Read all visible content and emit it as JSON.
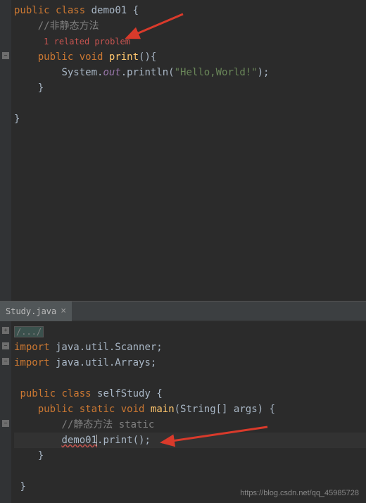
{
  "top_pane": {
    "code": {
      "l1_kw1": "public",
      "l1_kw2": "class",
      "l1_cls": "demo01",
      "l1_brace": " {",
      "l2_comment": "//非静态方法",
      "l3_problem": "1 related problem",
      "l4_kw1": "public",
      "l4_kw2": "void",
      "l4_method": "print",
      "l4_parens": "(){",
      "l5_sys": "System.",
      "l5_out": "out",
      "l5_print": ".println(",
      "l5_str": "\"Hello,World!\"",
      "l5_end": ");",
      "l6_brace": "}",
      "l7_brace": "}"
    }
  },
  "bottom_pane": {
    "tab_name": "Study.java",
    "code": {
      "folded": "/.../",
      "imp1_kw": "import",
      "imp1_rest": " java.util.Scanner;",
      "imp2_kw": "import",
      "imp2_rest": " java.util.Arrays;",
      "cls_kw1": "public",
      "cls_kw2": "class",
      "cls_name": "selfStudy",
      "cls_brace": " {",
      "main_kw1": "public",
      "main_kw2": "static",
      "main_kw3": "void",
      "main_method": "main",
      "main_params": "(String[] args) {",
      "comment": "//静态方法 static",
      "call_obj": "demo01",
      "call_method": ".print();",
      "close1": "}",
      "close2": "}"
    }
  },
  "watermark": "https://blog.csdn.net/qq_45985728"
}
